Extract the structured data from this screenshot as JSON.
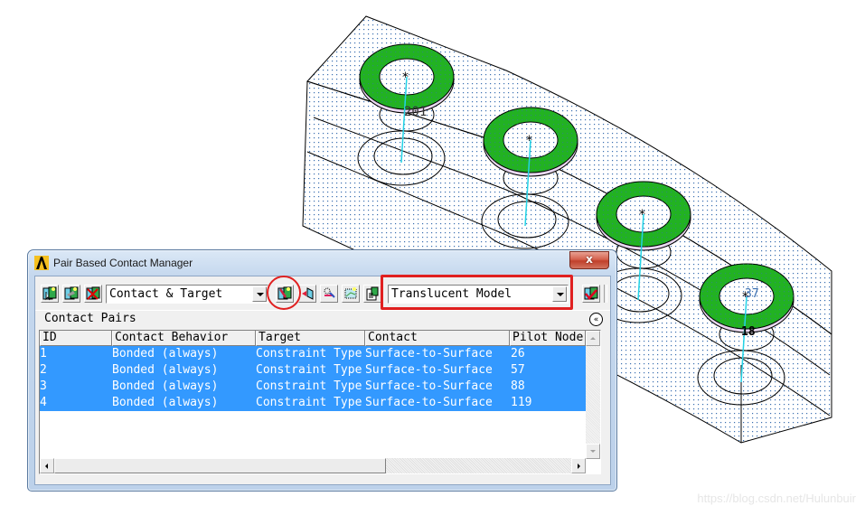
{
  "window": {
    "title": "Pair Based Contact Manager",
    "close_label": "x"
  },
  "toolbar": {
    "display_select": {
      "value": "Contact & Target"
    },
    "model_select": {
      "value": "Translucent Model"
    },
    "buttons": [
      {
        "name": "define-contact-pair-icon"
      },
      {
        "name": "edit-contact-pair-icon"
      },
      {
        "name": "delete-contact-pair-icon"
      },
      {
        "name": "contact-wizard-icon"
      },
      {
        "name": "flip-contact-target-icon"
      },
      {
        "name": "list-pairs-icon"
      },
      {
        "name": "plot-elements-icon"
      },
      {
        "name": "properties-icon"
      },
      {
        "name": "check-contact-icon"
      }
    ]
  },
  "section": {
    "label": "Contact Pairs",
    "collapse_icon": "«"
  },
  "table": {
    "columns": [
      "ID",
      "Contact Behavior",
      "Target",
      "Contact",
      "Pilot Node"
    ],
    "rows": [
      {
        "id": "1",
        "behavior": "Bonded (always)",
        "target": "Constraint Type",
        "contact": "Surface-to-Surface",
        "pilot": "26"
      },
      {
        "id": "2",
        "behavior": "Bonded (always)",
        "target": "Constraint Type",
        "contact": "Surface-to-Surface",
        "pilot": "57"
      },
      {
        "id": "3",
        "behavior": "Bonded (always)",
        "target": "Constraint Type",
        "contact": "Surface-to-Surface",
        "pilot": "88"
      },
      {
        "id": "4",
        "behavior": "Bonded (always)",
        "target": "Constraint Type",
        "contact": "Surface-to-Surface",
        "pilot": "119"
      }
    ],
    "selection_color": "#3399ff"
  },
  "model_view": {
    "labels": [
      "201",
      "37",
      "18"
    ],
    "ring_color": "#22b222",
    "pilot_line_color": "#22d3e6"
  },
  "annotation": {
    "highlight_color": "#e02020"
  },
  "watermark": "https://blog.csdn.net/Hulunbuir"
}
